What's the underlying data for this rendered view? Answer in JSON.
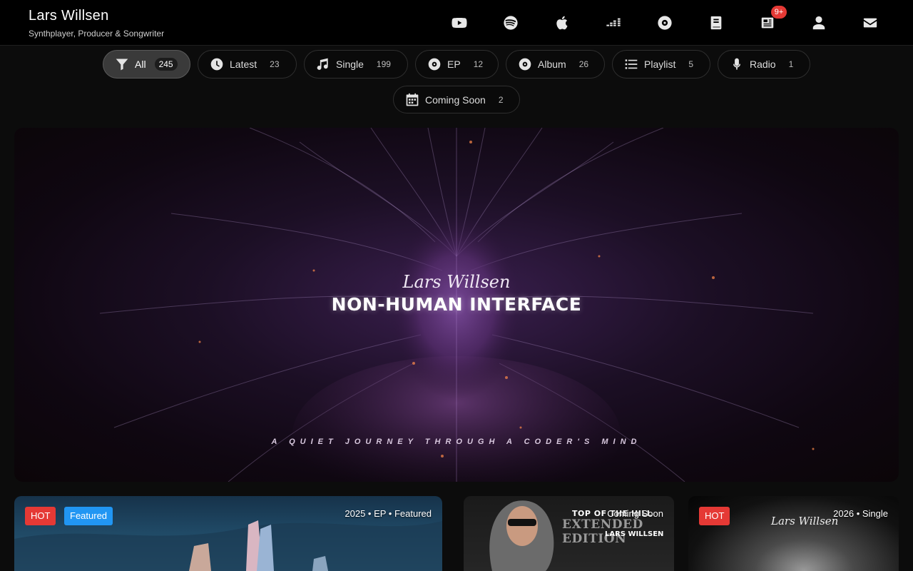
{
  "header": {
    "name": "Lars Willsen",
    "subtitle": "Synthplayer, Producer & Songwriter",
    "nav": [
      {
        "icon": "youtube-icon"
      },
      {
        "icon": "spotify-icon"
      },
      {
        "icon": "apple-icon"
      },
      {
        "icon": "deezer-icon"
      },
      {
        "icon": "disc-icon"
      },
      {
        "icon": "book-icon"
      },
      {
        "icon": "news-icon",
        "badge": "9+"
      },
      {
        "icon": "user-icon"
      },
      {
        "icon": "mail-icon"
      }
    ]
  },
  "filters": [
    {
      "label": "All",
      "count": "245",
      "icon": "filter-icon",
      "active": true
    },
    {
      "label": "Latest",
      "count": "23",
      "icon": "clock-icon"
    },
    {
      "label": "Single",
      "count": "199",
      "icon": "music-note-icon"
    },
    {
      "label": "EP",
      "count": "12",
      "icon": "disc-icon"
    },
    {
      "label": "Album",
      "count": "26",
      "icon": "disc-icon"
    },
    {
      "label": "Playlist",
      "count": "5",
      "icon": "list-icon"
    },
    {
      "label": "Radio",
      "count": "1",
      "icon": "microphone-icon"
    },
    {
      "label": "Coming Soon",
      "count": "2",
      "icon": "calendar-icon"
    }
  ],
  "hero": {
    "artist_script": "Lars Willsen",
    "title": "NON-HUMAN INTERFACE",
    "tagline": "A QUIET JOURNEY THROUGH A CODER'S MIND"
  },
  "cards": [
    {
      "tags": [
        "HOT",
        "Featured"
      ],
      "meta": "2025 • EP • Featured"
    },
    {
      "meta": "Coming Soon",
      "cover_title": "TOP OF THE HILL",
      "cover_subtitle": "EXTENDED EDITION",
      "cover_artist": "LARS WILLSEN"
    },
    {
      "tags": [
        "HOT"
      ],
      "meta": "2026 • Single",
      "cover_signature": "Lars Willsen"
    }
  ],
  "colors": {
    "accent_hot": "#e53935",
    "accent_featured": "#2196f3",
    "background": "#0c0c0c",
    "header": "#000000"
  }
}
